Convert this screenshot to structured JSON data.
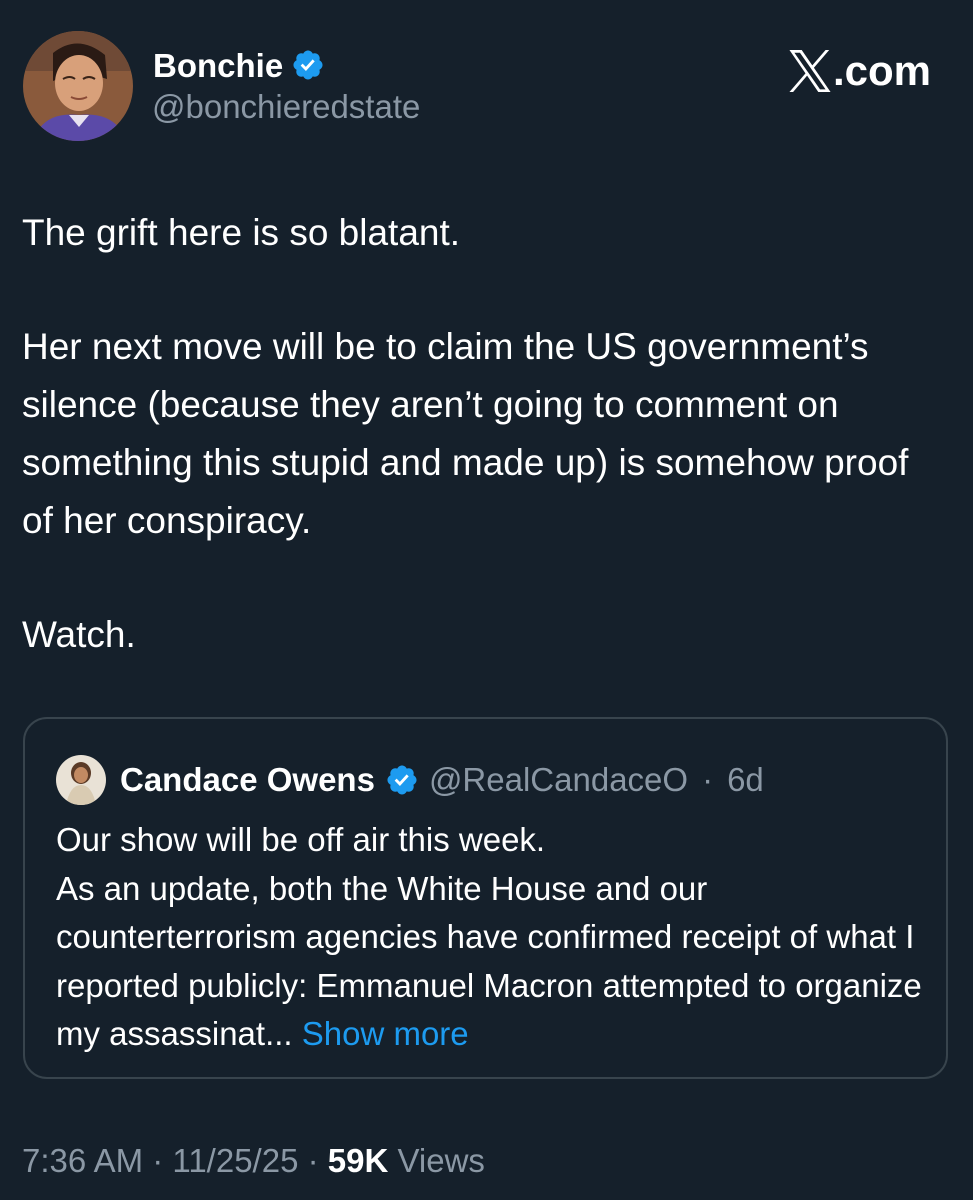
{
  "author": {
    "name": "Bonchie",
    "handle": "@bonchieredstate"
  },
  "watermark": "X.com",
  "tweet": {
    "paragraphs": [
      "The grift here is so blatant.",
      "Her next move will be to claim the US government’s silence (because they aren’t going to comment on something this stupid and made up) is somehow proof of her conspiracy.",
      "Watch."
    ]
  },
  "quote": {
    "name": "Candace Owens",
    "handle": "@RealCandaceO",
    "separator": "·",
    "age": "6d",
    "lines": [
      "Our show will be off air this week.",
      "As an update, both the White House and our counterterrorism agencies have confirmed receipt of what I reported publicly: Emmanuel Macron attempted to organize my assassinat..."
    ],
    "show_more": "Show more"
  },
  "meta": {
    "time": "7:36 AM",
    "separator": "·",
    "date": "11/25/25",
    "views_count": "59K",
    "views_label": "Views"
  },
  "colors": {
    "background": "#15202b",
    "secondary_text": "#8b98a5",
    "accent": "#1d9bf0",
    "border": "#38444d"
  },
  "icons": {
    "verified": "verified-badge-icon",
    "x_logo": "x-logo-icon"
  }
}
